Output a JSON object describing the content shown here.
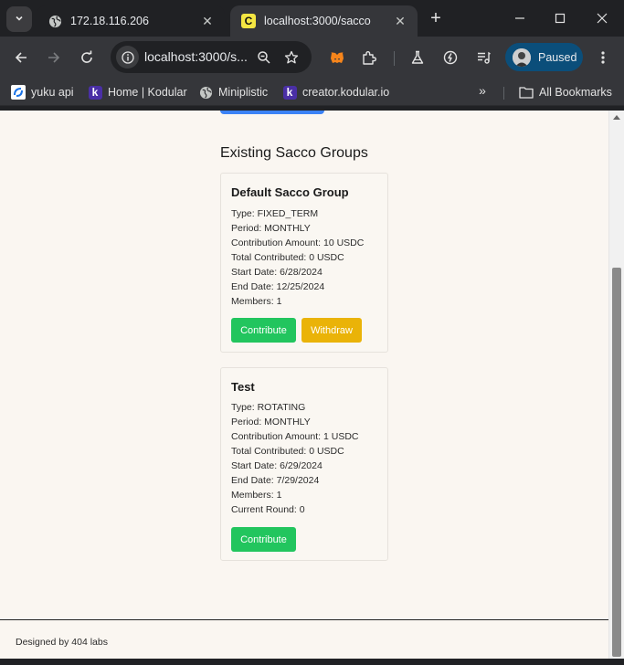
{
  "browser": {
    "tabs": [
      {
        "title": "172.18.116.206",
        "icon": "globe-icon"
      },
      {
        "title": "localhost:3000/sacco",
        "icon": "c-favicon-icon",
        "favicon_letter": "C",
        "active": true
      }
    ],
    "url": "localhost:3000/s...",
    "profile_status": "Paused",
    "bookmarks": [
      {
        "label": "yuku api",
        "icon": "yuku-icon"
      },
      {
        "label": "Home | Kodular",
        "icon": "kodular-icon",
        "icon_letter": "k"
      },
      {
        "label": "Miniplistic",
        "icon": "globe-icon"
      },
      {
        "label": "creator.kodular.io",
        "icon": "kodular-icon",
        "icon_letter": "k"
      }
    ],
    "all_bookmarks": "All Bookmarks",
    "colors": {
      "frame": "#202124",
      "toolbar": "#35363a",
      "profile": "#0b4e7a"
    }
  },
  "page": {
    "section_title": "Existing Sacco Groups",
    "groups": [
      {
        "name": "Default Sacco Group",
        "lines": [
          "Type: FIXED_TERM",
          "Period: MONTHLY",
          "Contribution Amount: 10 USDC",
          "Total Contributed: 0 USDC",
          "Start Date: 6/28/2024",
          "End Date: 12/25/2024",
          "Members: 1"
        ],
        "contribute_label": "Contribute",
        "withdraw_label": "Withdraw"
      },
      {
        "name": "Test",
        "lines": [
          "Type: ROTATING",
          "Period: MONTHLY",
          "Contribution Amount: 1 USDC",
          "Total Contributed: 0 USDC",
          "Start Date: 6/29/2024",
          "End Date: 7/29/2024",
          "Members: 1",
          "Current Round: 0"
        ],
        "contribute_label": "Contribute"
      }
    ],
    "footer": "Designed by 404 labs",
    "colors": {
      "background": "#faf6f1",
      "contribute": "#22c55e",
      "withdraw": "#eab308",
      "primary": "#3b82f6"
    }
  }
}
